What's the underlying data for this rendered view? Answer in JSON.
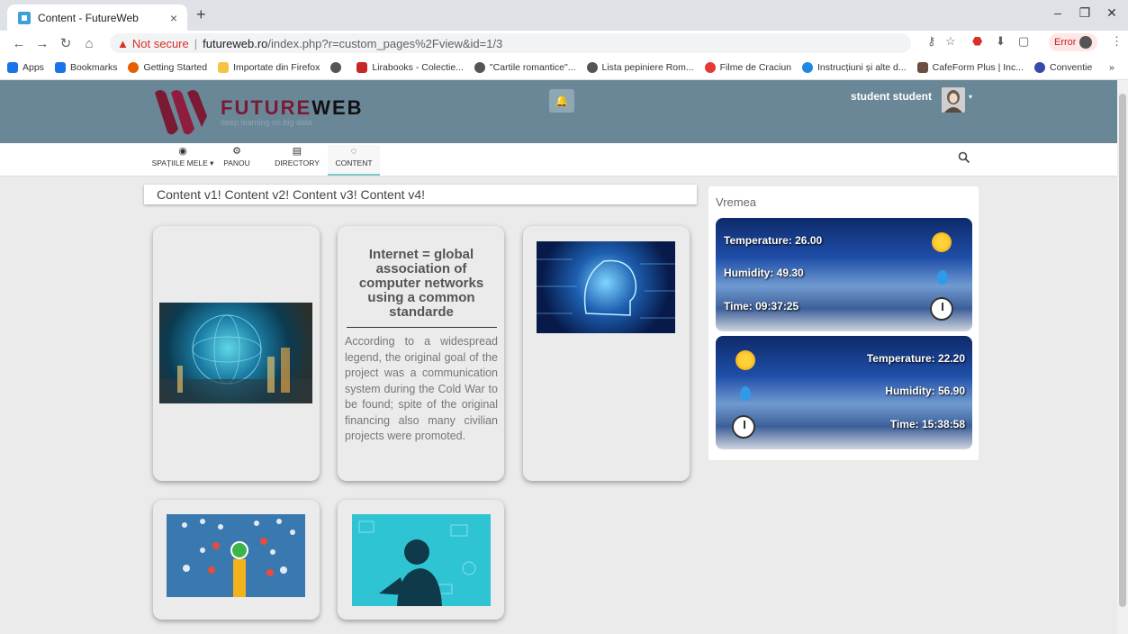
{
  "browser": {
    "tab_title": "Content - FutureWeb",
    "tab_close": "×",
    "new_tab": "+",
    "not_secure": "Not secure",
    "url_host": "futureweb.ro",
    "url_rest": "/index.php?r=custom_pages%2Fview&id=1/3",
    "error_label": "Error",
    "bookmarks": [
      {
        "label": "Apps",
        "color": "#1a73e8"
      },
      {
        "label": "Bookmarks",
        "color": "#1a73e8"
      },
      {
        "label": "Getting Started",
        "color": "#e66000"
      },
      {
        "label": "Importate din Firefox",
        "color": "#f6c343"
      },
      {
        "label": "",
        "color": "#555555"
      },
      {
        "label": "Lirabooks - Colectie...",
        "color": "#c62828"
      },
      {
        "label": "\"Cartile romantice\"...",
        "color": "#555555"
      },
      {
        "label": "Lista pepiniere Rom...",
        "color": "#555555"
      },
      {
        "label": "Filme de Craciun",
        "color": "#e53935"
      },
      {
        "label": "Instrucțiuni și alte d...",
        "color": "#1e88e5"
      },
      {
        "label": "CafeForm Plus | Inc...",
        "color": "#6d4c41"
      },
      {
        "label": "Conventie",
        "color": "#3949ab"
      }
    ],
    "more_bookmarks": "»"
  },
  "site": {
    "brand_future": "FUTURE",
    "brand_web": "WEB",
    "tagline": "deep learning on big data",
    "user_name": "student student",
    "menu": [
      {
        "label": "SPAȚIILE MELE ▾",
        "icon": "◉"
      },
      {
        "label": "PANOU",
        "icon": "⚙"
      },
      {
        "label": "DIRECTORY",
        "icon": "▤"
      },
      {
        "label": "CONTENT",
        "icon": "◌"
      }
    ],
    "content_bar": "Content v1!  Content v2!  Content v3!  Content v4!",
    "article": {
      "title": "Internet = global association of computer networks using a common standarde",
      "body": "According to a widespread legend, the original goal of the project was a communication system during the Cold War to be found; spite of the original financing also many civilian projects were promoted."
    },
    "weather_title": "Vremea",
    "weather": [
      {
        "temperature": "Temperature: 26.00",
        "humidity": "Humidity: 49.30",
        "time": "Time: 09:37:25"
      },
      {
        "temperature": "Temperature: 22.20",
        "humidity": "Humidity: 56.90",
        "time": "Time: 15:38:58"
      }
    ]
  }
}
